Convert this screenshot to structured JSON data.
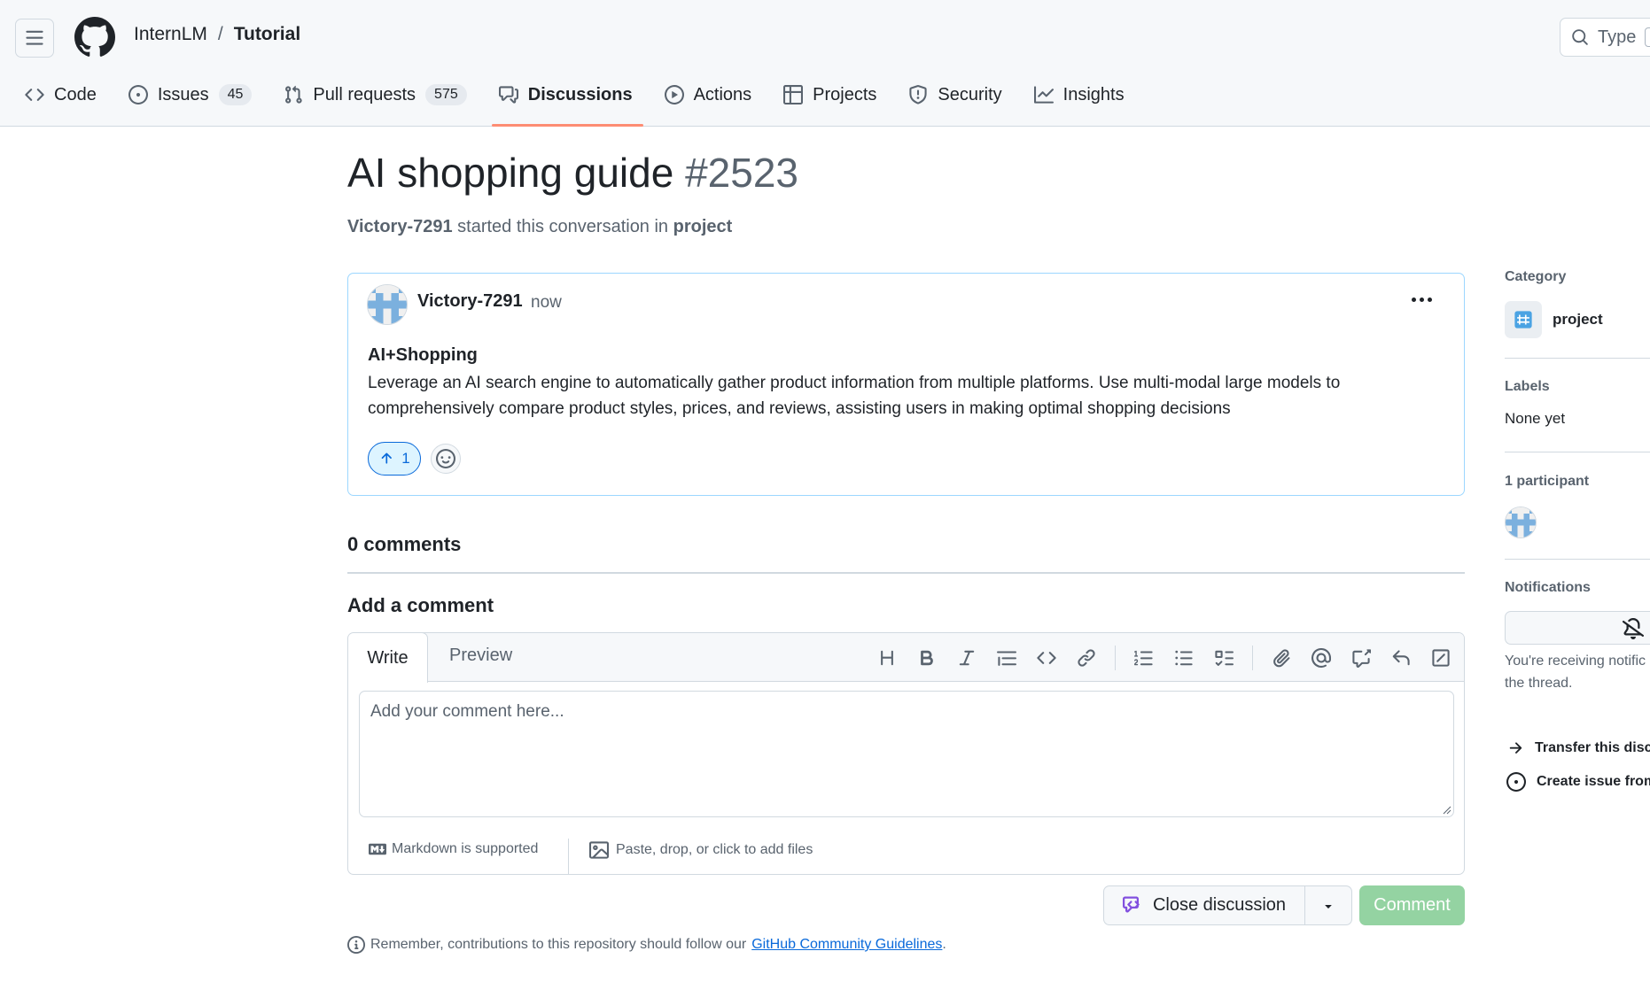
{
  "header": {
    "owner": "InternLM",
    "separator": "/",
    "repo": "Tutorial",
    "search_placeholder": "Type",
    "icons": [
      "hamburger-icon",
      "github-logo-icon",
      "search-icon"
    ]
  },
  "nav": {
    "items": [
      {
        "label": "Code",
        "icon": "code-icon"
      },
      {
        "label": "Issues",
        "icon": "issue-opened-icon",
        "count": "45"
      },
      {
        "label": "Pull requests",
        "icon": "git-pull-request-icon",
        "count": "575"
      },
      {
        "label": "Discussions",
        "icon": "comment-discussion-icon",
        "active": true
      },
      {
        "label": "Actions",
        "icon": "play-icon"
      },
      {
        "label": "Projects",
        "icon": "table-icon"
      },
      {
        "label": "Security",
        "icon": "shield-icon"
      },
      {
        "label": "Insights",
        "icon": "graph-icon"
      }
    ]
  },
  "discussion": {
    "title": "AI shopping guide",
    "number": "#2523",
    "author": "Victory-7291",
    "started_text": "started this conversation in",
    "category": "project"
  },
  "post": {
    "author": "Victory-7291",
    "time": "now",
    "body_title": "AI+Shopping",
    "body_text": "Leverage an AI search engine to automatically gather product information from multiple platforms. Use multi-modal large models to comprehensively compare product styles, prices, and reviews, assisting users in making optimal shopping decisions",
    "upvotes": "1"
  },
  "comments": {
    "count_label": "0 comments",
    "add_label": "Add a comment",
    "tab_write": "Write",
    "tab_preview": "Preview",
    "placeholder": "Add your comment here...",
    "markdown_note": "Markdown is supported",
    "files_note": "Paste, drop, or click to add files",
    "close_label": "Close discussion",
    "comment_label": "Comment",
    "guideline_text": "Remember, contributions to this repository should follow our",
    "guideline_link": "GitHub Community Guidelines",
    "guideline_end": "."
  },
  "sidebar": {
    "category_heading": "Category",
    "category_name": "project",
    "labels_heading": "Labels",
    "labels_value": "None yet",
    "participants_heading": "1 participant",
    "notifications_heading": "Notifications",
    "notifications_note_line1": "You're receiving notific",
    "notifications_note_line2": "the thread.",
    "transfer_label": "Transfer this disc",
    "create_issue_label": "Create issue from"
  },
  "colors": {
    "accent_blue": "#0969da",
    "nav_underline": "#fd8c73",
    "comment_button": "#94d3a2",
    "post_border": "#9cd7ff"
  }
}
